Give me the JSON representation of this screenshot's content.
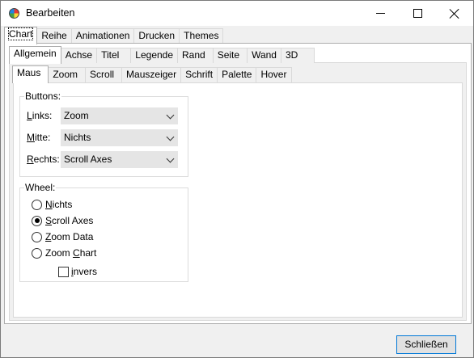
{
  "window": {
    "title": "Bearbeiten"
  },
  "tabs_level1": [
    "Chart",
    "Reihe",
    "Animationen",
    "Drucken",
    "Themes"
  ],
  "tabs_level2": [
    "Allgemein",
    "Achse",
    "Titel",
    "Legende",
    "Rand",
    "Seite",
    "Wand",
    "3D"
  ],
  "tabs_level3": [
    "Maus",
    "Zoom",
    "Scroll",
    "Mauszeiger",
    "Schrift",
    "Palette",
    "Hover"
  ],
  "buttons_group": {
    "label": "Buttons:",
    "links_label": "Links:",
    "links_value": "Zoom",
    "mitte_label": "Mitte:",
    "mitte_value": "Nichts",
    "rechts_label": "Rechts:",
    "rechts_value": "Scroll Axes"
  },
  "wheel_group": {
    "label": "Wheel:",
    "options": [
      "Nichts",
      "Scroll Axes",
      "Zoom Data",
      "Zoom Chart"
    ],
    "selected": "Scroll Axes",
    "invers_label": "invers",
    "invers_checked": false
  },
  "footer": {
    "close_label": "Schließen"
  },
  "colors": {
    "accent": "#0078d7",
    "panel": "#ffffff",
    "chrome": "#f0f0f0"
  }
}
